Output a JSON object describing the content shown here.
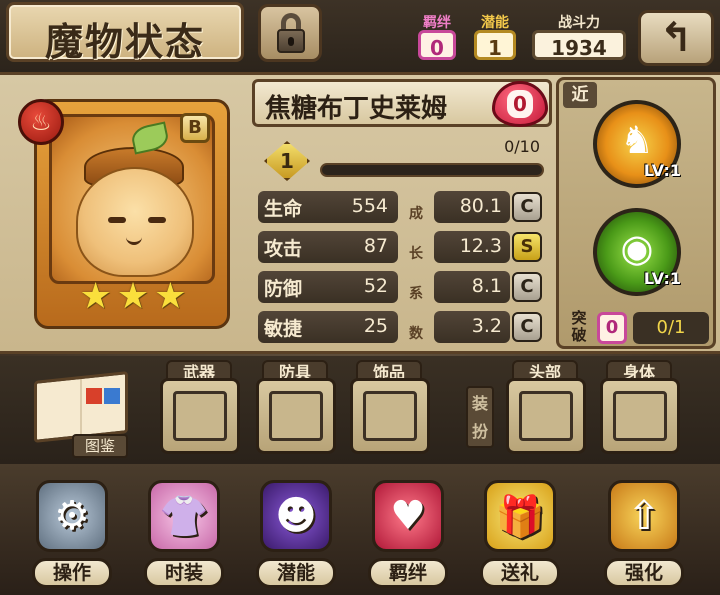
{
  "header": {
    "title": "魔物状态",
    "bond": {
      "label": "羁绊",
      "value": "0"
    },
    "potential": {
      "label": "潜能",
      "value": "1"
    },
    "power": {
      "label": "战斗力",
      "value": "1934"
    },
    "back_glyph": "↰",
    "lock_icon": "lock-icon"
  },
  "monster": {
    "name": "焦糖布丁史莱姆",
    "affinity": "0",
    "element_glyph": "♨",
    "rank": "B",
    "stars": [
      "★",
      "★",
      "★"
    ],
    "star_count": 3,
    "level": "1",
    "exp_text": "0/10",
    "exp_fraction": 0.0
  },
  "stats": [
    {
      "name": "生命",
      "value": "554",
      "growth": "80.1",
      "grade": "C"
    },
    {
      "name": "攻击",
      "value": "87",
      "growth": "12.3",
      "grade": "S"
    },
    {
      "name": "防御",
      "value": "52",
      "growth": "8.1",
      "grade": "C"
    },
    {
      "name": "敏捷",
      "value": "25",
      "growth": "3.2",
      "grade": "C"
    }
  ],
  "growth_chars": [
    "成",
    "长",
    "系",
    "数"
  ],
  "skills": {
    "range_tag": "近",
    "skill1": {
      "glyph": "♞",
      "lv": "LV:1"
    },
    "skill2": {
      "glyph": "◉",
      "lv": "LV:1"
    },
    "breakthrough": {
      "label": "突破",
      "count": "0",
      "progress": "0/1"
    }
  },
  "equipment": {
    "codex_label": "图鉴",
    "weapon": "武器",
    "armor": "防具",
    "accessory": "饰品",
    "dress_tag": "装扮",
    "head": "头部",
    "body": "身体"
  },
  "nav": [
    {
      "label": "操作",
      "glyph": "⚙"
    },
    {
      "label": "时装",
      "glyph": "👚"
    },
    {
      "label": "潜能",
      "glyph": "☻"
    },
    {
      "label": "羁绊",
      "glyph": "♥"
    },
    {
      "label": "送礼",
      "glyph": "🎁"
    },
    {
      "label": "强化",
      "glyph": "⇧"
    }
  ],
  "colors": {
    "bond_pink": "#c8489a",
    "potential_gold": "#b48a22",
    "grade_s": "#f6e46a",
    "grade_c": "#e8e0d0"
  }
}
